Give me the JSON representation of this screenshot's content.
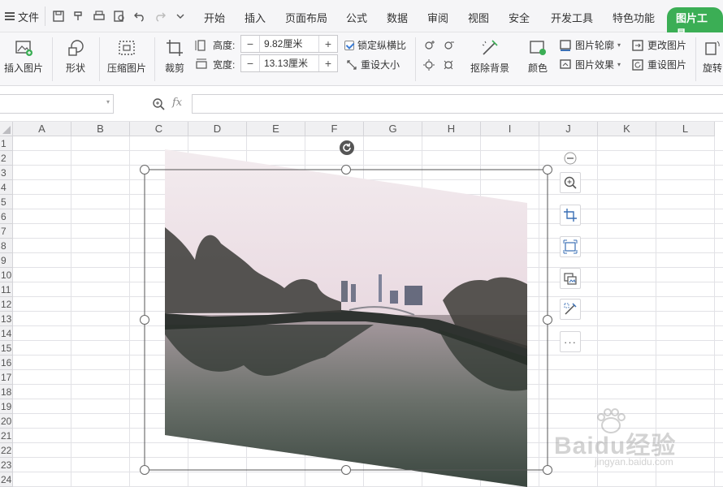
{
  "menubar": {
    "file_label": "文件",
    "tabs": [
      "开始",
      "插入",
      "页面布局",
      "公式",
      "数据",
      "审阅",
      "视图",
      "安全",
      "开发工具",
      "特色功能"
    ],
    "active_tab": "图片工具"
  },
  "ribbon": {
    "insert_picture": "插入图片",
    "shape": "形状",
    "compress": "压缩图片",
    "crop": "裁剪",
    "height_label": "高度:",
    "height_value": "9.82厘米",
    "width_label": "宽度:",
    "width_value": "13.13厘米",
    "lock_ratio": "锁定纵横比",
    "reset_size": "重设大小",
    "remove_bg": "抠除背景",
    "color": "颜色",
    "outline": "图片轮廓",
    "effects": "图片效果",
    "change_picture": "更改图片",
    "reset_picture": "重设图片",
    "rotate": "旋转"
  },
  "formula": {
    "fx": "fx",
    "name_value": "",
    "formula_value": ""
  },
  "grid": {
    "columns": [
      "A",
      "B",
      "C",
      "D",
      "E",
      "F",
      "G",
      "H",
      "I",
      "J",
      "K",
      "L"
    ],
    "rows": [
      "1",
      "2",
      "3",
      "4",
      "5",
      "6",
      "7",
      "8",
      "9",
      "10",
      "11",
      "12",
      "13",
      "14",
      "15",
      "16",
      "17",
      "18",
      "19",
      "20",
      "21",
      "22",
      "23",
      "24"
    ]
  },
  "picture_tools": {
    "more": "···"
  },
  "watermark": {
    "line1": "Baidu经验",
    "line2": "jingyan.baidu.com"
  },
  "colors": {
    "accent_green": "#3bae55",
    "icon_blue": "#3a6fb5"
  }
}
